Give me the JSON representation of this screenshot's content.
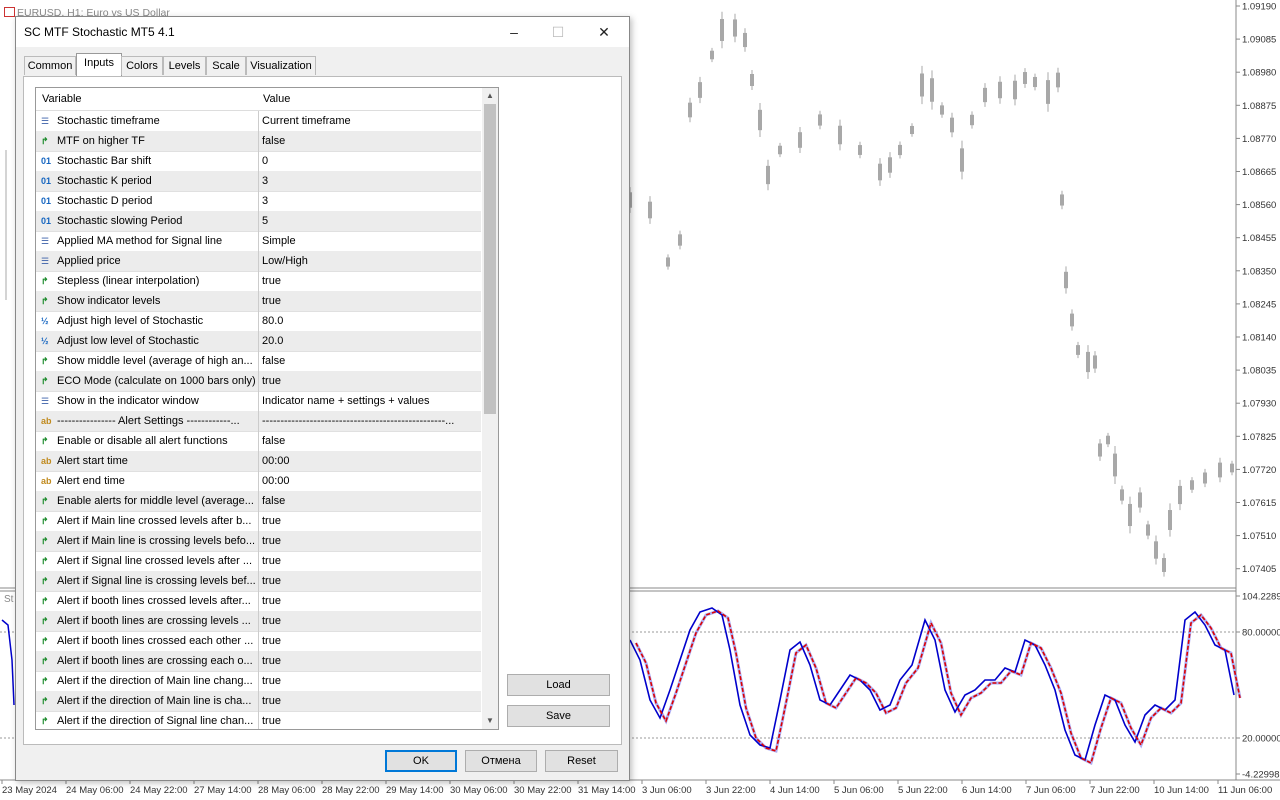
{
  "chart": {
    "caption": "EURUSD, H1:  Euro vs US Dollar",
    "sub_caption": "St",
    "price_labels": [
      "1.09190",
      "1.09085",
      "1.08980",
      "1.08875",
      "1.08770",
      "1.08665",
      "1.08560",
      "1.08455",
      "1.08350",
      "1.08245",
      "1.08140",
      "1.08035",
      "1.07930",
      "1.07825",
      "1.07720",
      "1.07615",
      "1.07510",
      "1.07405"
    ],
    "osc_labels": [
      "104.2289",
      "80.00000",
      "20.00000",
      "-4.22998"
    ],
    "time_labels": [
      "23 May 2024",
      "24 May 06:00",
      "24 May 22:00",
      "27 May 14:00",
      "28 May 06:00",
      "28 May 22:00",
      "29 May 14:00",
      "30 May 06:00",
      "30 May 22:00",
      "31 May 14:00",
      "3 Jun 06:00",
      "3 Jun 22:00",
      "4 Jun 14:00",
      "5 Jun 06:00",
      "5 Jun 22:00",
      "6 Jun 14:00",
      "7 Jun 06:00",
      "7 Jun 22:00",
      "10 Jun 14:00",
      "11 Jun 06:00"
    ],
    "colors": {
      "candle": "#a8a8a8",
      "main_line": "#0000cc",
      "signal_line": "#dd0000",
      "fill": "#8c8cf0"
    }
  },
  "dialog": {
    "title": "SC MTF Stochastic MT5 4.1",
    "minimize": "–",
    "maximize": "☐",
    "close": "✕",
    "tabs": [
      "Common",
      "Inputs",
      "Colors",
      "Levels",
      "Scale",
      "Visualization"
    ],
    "active_tab": "Inputs",
    "grid": {
      "col_variable": "Variable",
      "col_value": "Value",
      "rows": [
        {
          "icon": "enum",
          "name": "Stochastic timeframe",
          "value": "Current timeframe"
        },
        {
          "icon": "bool",
          "name": "MTF on higher TF",
          "value": "false"
        },
        {
          "icon": "int",
          "name": "Stochastic Bar shift",
          "value": "0"
        },
        {
          "icon": "int",
          "name": "Stochastic K period",
          "value": "3"
        },
        {
          "icon": "int",
          "name": "Stochastic D period",
          "value": "3"
        },
        {
          "icon": "int",
          "name": "Stochastic slowing Period",
          "value": "5"
        },
        {
          "icon": "enum",
          "name": "Applied MA method for Signal line",
          "value": "Simple"
        },
        {
          "icon": "enum",
          "name": "Applied price",
          "value": "Low/High"
        },
        {
          "icon": "bool",
          "name": "Stepless (linear interpolation)",
          "value": "true"
        },
        {
          "icon": "bool",
          "name": "Show indicator levels",
          "value": "true"
        },
        {
          "icon": "dbl",
          "name": "Adjust high level of Stochastic",
          "value": "80.0"
        },
        {
          "icon": "dbl",
          "name": "Adjust low level of Stochastic",
          "value": "20.0"
        },
        {
          "icon": "bool",
          "name": "Show middle level (average of high an...",
          "value": "false"
        },
        {
          "icon": "bool",
          "name": "ECO Mode (calculate on 1000 bars only)",
          "value": "true"
        },
        {
          "icon": "enum",
          "name": "Show in the indicator window",
          "value": "Indicator name + settings + values"
        },
        {
          "icon": "str",
          "name": "---------------- Alert Settings ------------...",
          "value": "--------------------------------------------------..."
        },
        {
          "icon": "bool",
          "name": "Enable or disable all alert functions",
          "value": "false"
        },
        {
          "icon": "str",
          "name": "Alert start time",
          "value": "00:00"
        },
        {
          "icon": "str",
          "name": "Alert end time",
          "value": "00:00"
        },
        {
          "icon": "bool",
          "name": "Enable alerts for middle level (average...",
          "value": "false"
        },
        {
          "icon": "bool",
          "name": "Alert if Main line crossed levels after b...",
          "value": "true"
        },
        {
          "icon": "bool",
          "name": "Alert if Main line is crossing levels befo...",
          "value": "true"
        },
        {
          "icon": "bool",
          "name": "Alert if Signal line crossed levels after ...",
          "value": "true"
        },
        {
          "icon": "bool",
          "name": "Alert if Signal line is crossing levels bef...",
          "value": "true"
        },
        {
          "icon": "bool",
          "name": "Alert if booth lines crossed levels after...",
          "value": "true"
        },
        {
          "icon": "bool",
          "name": "Alert if booth lines are crossing levels ...",
          "value": "true"
        },
        {
          "icon": "bool",
          "name": "Alert if booth lines crossed each other ...",
          "value": "true"
        },
        {
          "icon": "bool",
          "name": "Alert if booth lines are crossing each o...",
          "value": "true"
        },
        {
          "icon": "bool",
          "name": "Alert if the direction of Main line chang...",
          "value": "true"
        },
        {
          "icon": "bool",
          "name": "Alert if the direction of Main line is cha...",
          "value": "true"
        },
        {
          "icon": "bool",
          "name": "Alert if the direction of Signal line chan...",
          "value": "true"
        }
      ]
    },
    "buttons": {
      "load": "Load",
      "save": "Save",
      "ok": "OK",
      "cancel": "Отмена",
      "reset": "Reset"
    }
  }
}
